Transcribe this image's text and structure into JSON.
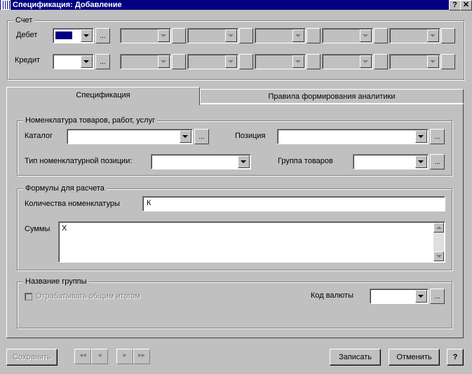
{
  "window": {
    "title": "Спецификация: Добавление",
    "help_button": "?",
    "close_button": "✕"
  },
  "account_group": {
    "title": "Счет",
    "debit_label": "Дебет",
    "credit_label": "Кредит",
    "debit_color": "#000080",
    "dots": "..."
  },
  "tabs": [
    {
      "label": "Спецификация",
      "active": true
    },
    {
      "label": "Правила формирования аналитики",
      "active": false
    }
  ],
  "nomenclature_group": {
    "title": "Номенклатура товаров, работ, услуг",
    "catalog_label": "Каталог",
    "position_label": "Позиция",
    "type_label": "Тип номенклатурной позиции:",
    "goods_group_label": "Группа товаров"
  },
  "formulas_group": {
    "title": "Формулы для расчета",
    "quantity_label": "Количества номенклатуры",
    "quantity_value": "К",
    "sums_label": "Суммы",
    "sums_value": "Х"
  },
  "group_name_group": {
    "title": "Название группы",
    "checkbox_label": "Отрабатывать общим итогом",
    "currency_label": "Код валюты"
  },
  "footer": {
    "save_label": "Сохранить",
    "first": "◂◂",
    "prev": "◂",
    "next": "▸",
    "last": "▸▸",
    "write_label": "Записать",
    "cancel_label": "Отменить",
    "help_label": "?"
  }
}
